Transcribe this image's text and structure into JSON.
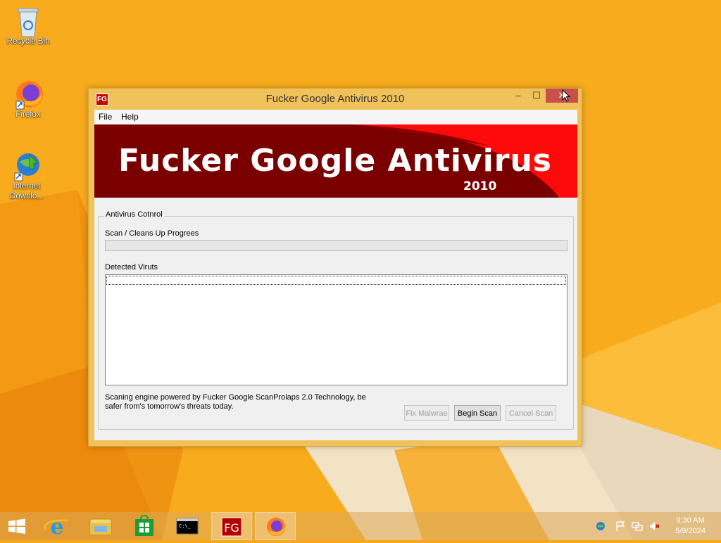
{
  "desktop": {
    "icons": [
      {
        "label": "Recycle Bin",
        "icon": "recycle-bin-icon"
      },
      {
        "label": "Firefox",
        "icon": "firefox-icon"
      },
      {
        "label": "Internet Downlo...",
        "icon": "internet-download-manager-icon"
      }
    ]
  },
  "window": {
    "title": "Fucker Google Antivirus 2010",
    "icon_text": "FG",
    "controls": {
      "minimize": "–",
      "maximize": "☐",
      "close": "✕"
    },
    "menu": [
      "File",
      "Help"
    ],
    "banner": {
      "title": "Fucker Google Antivirus",
      "year": "2010"
    },
    "group_title": "Antivirus Cotnrol",
    "progress_label": "Scan / Cleans Up Progrees",
    "progress_value": 0,
    "detected_label": "Detected Viruts",
    "info_line1": "Scaning engine powered by Fucker Google ScanProlaps 2.0 Technology, be",
    "info_line2": "safer from's tomorrow's threats today.",
    "buttons": {
      "fix": "Fix Malwrae",
      "begin": "Begin Scan",
      "cancel": "Cancel Scan"
    }
  },
  "taskbar": {
    "apps": [
      {
        "name": "start",
        "icon": "windows-start-icon"
      },
      {
        "name": "internet-explorer",
        "icon": "internet-explorer-icon"
      },
      {
        "name": "file-explorer",
        "icon": "file-explorer-icon"
      },
      {
        "name": "store",
        "icon": "store-icon"
      },
      {
        "name": "command-prompt",
        "icon": "command-prompt-icon"
      },
      {
        "name": "fg-antivirus",
        "icon": "fg-app-icon"
      },
      {
        "name": "firefox",
        "icon": "firefox-icon"
      }
    ],
    "taskbar_cmd_text": "C:\\_",
    "taskbar_fg_text": "FG",
    "time": "9:30 AM",
    "date": "5/9/2024"
  },
  "colors": {
    "desktop": "#f7a91c",
    "banner_dark": "#7a0000",
    "banner_red": "#ff0a0a"
  }
}
